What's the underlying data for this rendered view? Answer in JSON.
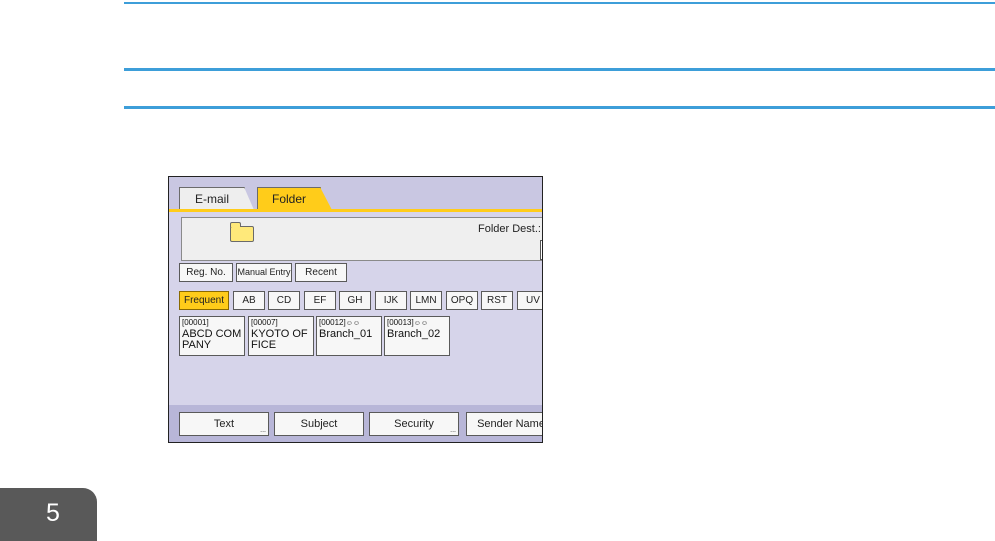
{
  "tabs": {
    "email": "E-mail",
    "folder": "Folder"
  },
  "destination": {
    "label": "Folder Dest.:"
  },
  "lookup": {
    "reg_no": "Reg. No.",
    "manual_entry": "Manual Entry",
    "recent": "Recent"
  },
  "index": [
    "Frequent",
    "AB",
    "CD",
    "EF",
    "GH",
    "IJK",
    "LMN",
    "OPQ",
    "RST",
    "UV"
  ],
  "entries": [
    {
      "code": "[00001]",
      "name": "ABCD COMPANY",
      "group": ""
    },
    {
      "code": "[00007]",
      "name": "KYOTO OFFICE",
      "group": ""
    },
    {
      "code": "[00012]",
      "name": "Branch_01",
      "group": "☺☺"
    },
    {
      "code": "[00013]",
      "name": "Branch_02",
      "group": "☺☺"
    }
  ],
  "bottom": {
    "text": "Text",
    "subject": "Subject",
    "security": "Security",
    "sender_name": "Sender Name"
  },
  "chapter": "5",
  "colors": {
    "accent": "#3d9ed9",
    "selected_tab": "#ffcc1a",
    "panel_bg": "#d6d4ea"
  }
}
